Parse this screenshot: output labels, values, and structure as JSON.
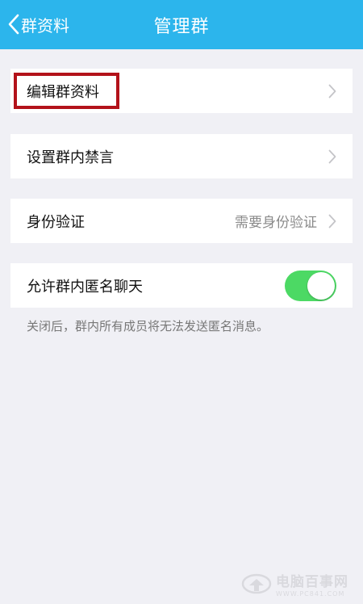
{
  "navbar": {
    "back_label": "群资料",
    "title": "管理群",
    "color": "#2cb5ec"
  },
  "rows": {
    "edit": {
      "label": "编辑群资料"
    },
    "mute": {
      "label": "设置群内禁言"
    },
    "verify": {
      "label": "身份验证",
      "value": "需要身份验证"
    },
    "anon": {
      "label": "允许群内匿名聊天",
      "toggle_on": true
    }
  },
  "note": "关闭后，群内所有成员将无法发送匿名消息。",
  "highlight_color": "#b3121a",
  "toggle_color": "#4cd964",
  "watermark": {
    "main": "电脑百事网",
    "sub": "WWW.PC841.COM"
  }
}
